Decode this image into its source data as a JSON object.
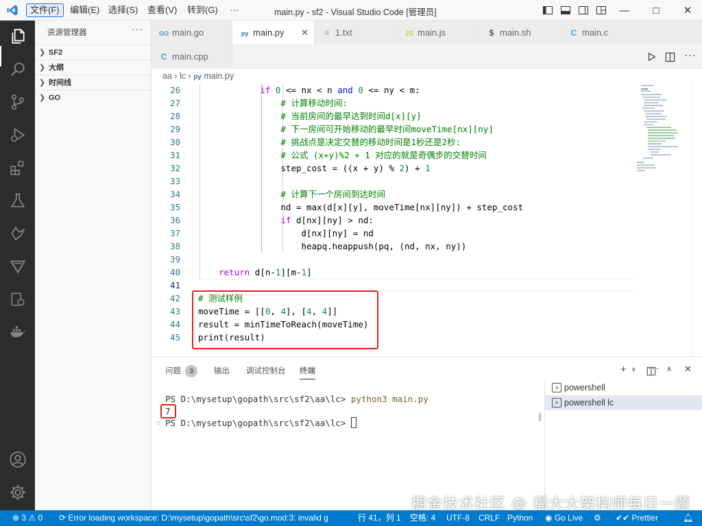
{
  "titlebar": {
    "menu": [
      "文件(F)",
      "编辑(E)",
      "选择(S)",
      "查看(V)",
      "转到(G)",
      "···"
    ],
    "title": "main.py - sf2 - Visual Studio Code [管理员]"
  },
  "sidebar": {
    "title": "资源管理器",
    "more": "···",
    "sections": [
      "SF2",
      "大纲",
      "时间线",
      "GO"
    ]
  },
  "tabs": [
    {
      "icon": "go-file-icon",
      "glyph": "GO",
      "label": "main.go",
      "color": "#519aba"
    },
    {
      "icon": "python-file-icon",
      "glyph": "py",
      "label": "main.py",
      "color": "#3572a5",
      "active": true
    },
    {
      "icon": "text-file-icon",
      "glyph": "≡",
      "label": "1.txt",
      "color": "#999999"
    },
    {
      "icon": "js-file-icon",
      "glyph": "JS",
      "label": "main.js",
      "color": "#cbcb41"
    },
    {
      "icon": "shell-file-icon",
      "glyph": "$",
      "label": "main.sh",
      "color": "#4d5a5e"
    },
    {
      "icon": "c-file-icon",
      "glyph": "C",
      "label": "main.c",
      "color": "#519aba"
    },
    {
      "icon": "cpp-file-icon",
      "glyph": "C",
      "label": "main.cpp",
      "color": "#519aba"
    }
  ],
  "breadcrumb": [
    "aa",
    "lc",
    "main.py"
  ],
  "editor": {
    "line_numbers": [
      "26",
      "27",
      "28",
      "29",
      "30",
      "31",
      "32",
      "33",
      "34",
      "35",
      "36",
      "37",
      "38",
      "39",
      "40",
      "41",
      "42",
      "43",
      "44",
      "45"
    ],
    "current_line": "41"
  },
  "panel": {
    "tabs": [
      "问题",
      "输出",
      "调试控制台",
      "终端"
    ],
    "problems_count": "3",
    "terminal_lines": {
      "prompt1": "PS D:\\mysetup\\gopath\\src\\sf2\\aa\\lc> ",
      "cmd1": "python3 main.py",
      "output": "7",
      "prompt2": "PS D:\\mysetup\\gopath\\src\\sf2\\aa\\lc> "
    },
    "terminals": [
      "powershell",
      "powershell  lc"
    ]
  },
  "watermark": "掘金技术社区 @ 福大大架构师每日一题",
  "statusbar": {
    "errors": "3",
    "warnings": "0",
    "message": "Error loading workspace: D:\\mysetup\\gopath\\src\\sf2\\go.mod:3: invalid g",
    "position": "行 41，列 1",
    "spaces": "空格: 4",
    "encoding": "UTF-8",
    "eol": "CRLF",
    "language": "Python",
    "golive": "Go Live",
    "prettier": "Prettier"
  },
  "colors": {
    "statusbar": "#007acc",
    "activitybar": "#2c2c2c",
    "highlight_box": "#e02020"
  }
}
